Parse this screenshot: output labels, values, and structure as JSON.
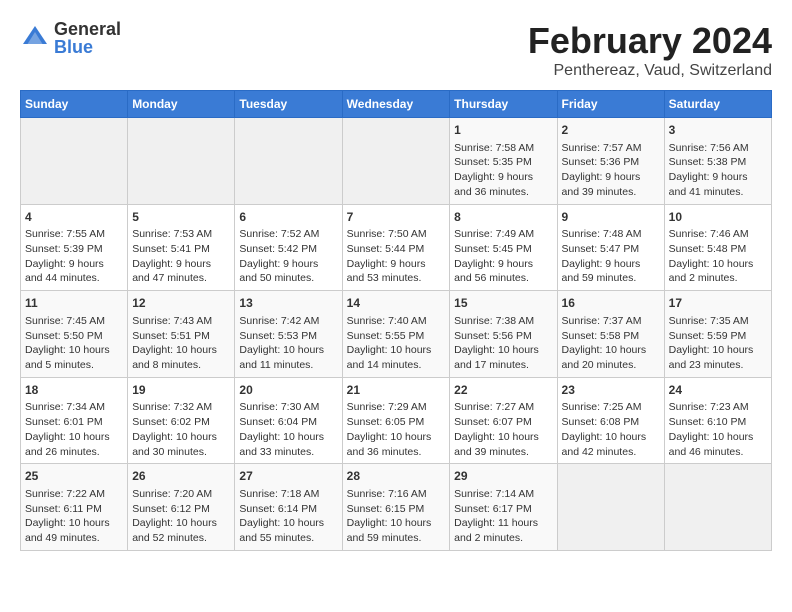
{
  "header": {
    "logo_general": "General",
    "logo_blue": "Blue",
    "title": "February 2024",
    "subtitle": "Penthereaz, Vaud, Switzerland"
  },
  "weekdays": [
    "Sunday",
    "Monday",
    "Tuesday",
    "Wednesday",
    "Thursday",
    "Friday",
    "Saturday"
  ],
  "weeks": [
    [
      {
        "day": "",
        "info": ""
      },
      {
        "day": "",
        "info": ""
      },
      {
        "day": "",
        "info": ""
      },
      {
        "day": "",
        "info": ""
      },
      {
        "day": "1",
        "info": "Sunrise: 7:58 AM\nSunset: 5:35 PM\nDaylight: 9 hours\nand 36 minutes."
      },
      {
        "day": "2",
        "info": "Sunrise: 7:57 AM\nSunset: 5:36 PM\nDaylight: 9 hours\nand 39 minutes."
      },
      {
        "day": "3",
        "info": "Sunrise: 7:56 AM\nSunset: 5:38 PM\nDaylight: 9 hours\nand 41 minutes."
      }
    ],
    [
      {
        "day": "4",
        "info": "Sunrise: 7:55 AM\nSunset: 5:39 PM\nDaylight: 9 hours\nand 44 minutes."
      },
      {
        "day": "5",
        "info": "Sunrise: 7:53 AM\nSunset: 5:41 PM\nDaylight: 9 hours\nand 47 minutes."
      },
      {
        "day": "6",
        "info": "Sunrise: 7:52 AM\nSunset: 5:42 PM\nDaylight: 9 hours\nand 50 minutes."
      },
      {
        "day": "7",
        "info": "Sunrise: 7:50 AM\nSunset: 5:44 PM\nDaylight: 9 hours\nand 53 minutes."
      },
      {
        "day": "8",
        "info": "Sunrise: 7:49 AM\nSunset: 5:45 PM\nDaylight: 9 hours\nand 56 minutes."
      },
      {
        "day": "9",
        "info": "Sunrise: 7:48 AM\nSunset: 5:47 PM\nDaylight: 9 hours\nand 59 minutes."
      },
      {
        "day": "10",
        "info": "Sunrise: 7:46 AM\nSunset: 5:48 PM\nDaylight: 10 hours\nand 2 minutes."
      }
    ],
    [
      {
        "day": "11",
        "info": "Sunrise: 7:45 AM\nSunset: 5:50 PM\nDaylight: 10 hours\nand 5 minutes."
      },
      {
        "day": "12",
        "info": "Sunrise: 7:43 AM\nSunset: 5:51 PM\nDaylight: 10 hours\nand 8 minutes."
      },
      {
        "day": "13",
        "info": "Sunrise: 7:42 AM\nSunset: 5:53 PM\nDaylight: 10 hours\nand 11 minutes."
      },
      {
        "day": "14",
        "info": "Sunrise: 7:40 AM\nSunset: 5:55 PM\nDaylight: 10 hours\nand 14 minutes."
      },
      {
        "day": "15",
        "info": "Sunrise: 7:38 AM\nSunset: 5:56 PM\nDaylight: 10 hours\nand 17 minutes."
      },
      {
        "day": "16",
        "info": "Sunrise: 7:37 AM\nSunset: 5:58 PM\nDaylight: 10 hours\nand 20 minutes."
      },
      {
        "day": "17",
        "info": "Sunrise: 7:35 AM\nSunset: 5:59 PM\nDaylight: 10 hours\nand 23 minutes."
      }
    ],
    [
      {
        "day": "18",
        "info": "Sunrise: 7:34 AM\nSunset: 6:01 PM\nDaylight: 10 hours\nand 26 minutes."
      },
      {
        "day": "19",
        "info": "Sunrise: 7:32 AM\nSunset: 6:02 PM\nDaylight: 10 hours\nand 30 minutes."
      },
      {
        "day": "20",
        "info": "Sunrise: 7:30 AM\nSunset: 6:04 PM\nDaylight: 10 hours\nand 33 minutes."
      },
      {
        "day": "21",
        "info": "Sunrise: 7:29 AM\nSunset: 6:05 PM\nDaylight: 10 hours\nand 36 minutes."
      },
      {
        "day": "22",
        "info": "Sunrise: 7:27 AM\nSunset: 6:07 PM\nDaylight: 10 hours\nand 39 minutes."
      },
      {
        "day": "23",
        "info": "Sunrise: 7:25 AM\nSunset: 6:08 PM\nDaylight: 10 hours\nand 42 minutes."
      },
      {
        "day": "24",
        "info": "Sunrise: 7:23 AM\nSunset: 6:10 PM\nDaylight: 10 hours\nand 46 minutes."
      }
    ],
    [
      {
        "day": "25",
        "info": "Sunrise: 7:22 AM\nSunset: 6:11 PM\nDaylight: 10 hours\nand 49 minutes."
      },
      {
        "day": "26",
        "info": "Sunrise: 7:20 AM\nSunset: 6:12 PM\nDaylight: 10 hours\nand 52 minutes."
      },
      {
        "day": "27",
        "info": "Sunrise: 7:18 AM\nSunset: 6:14 PM\nDaylight: 10 hours\nand 55 minutes."
      },
      {
        "day": "28",
        "info": "Sunrise: 7:16 AM\nSunset: 6:15 PM\nDaylight: 10 hours\nand 59 minutes."
      },
      {
        "day": "29",
        "info": "Sunrise: 7:14 AM\nSunset: 6:17 PM\nDaylight: 11 hours\nand 2 minutes."
      },
      {
        "day": "",
        "info": ""
      },
      {
        "day": "",
        "info": ""
      }
    ]
  ]
}
